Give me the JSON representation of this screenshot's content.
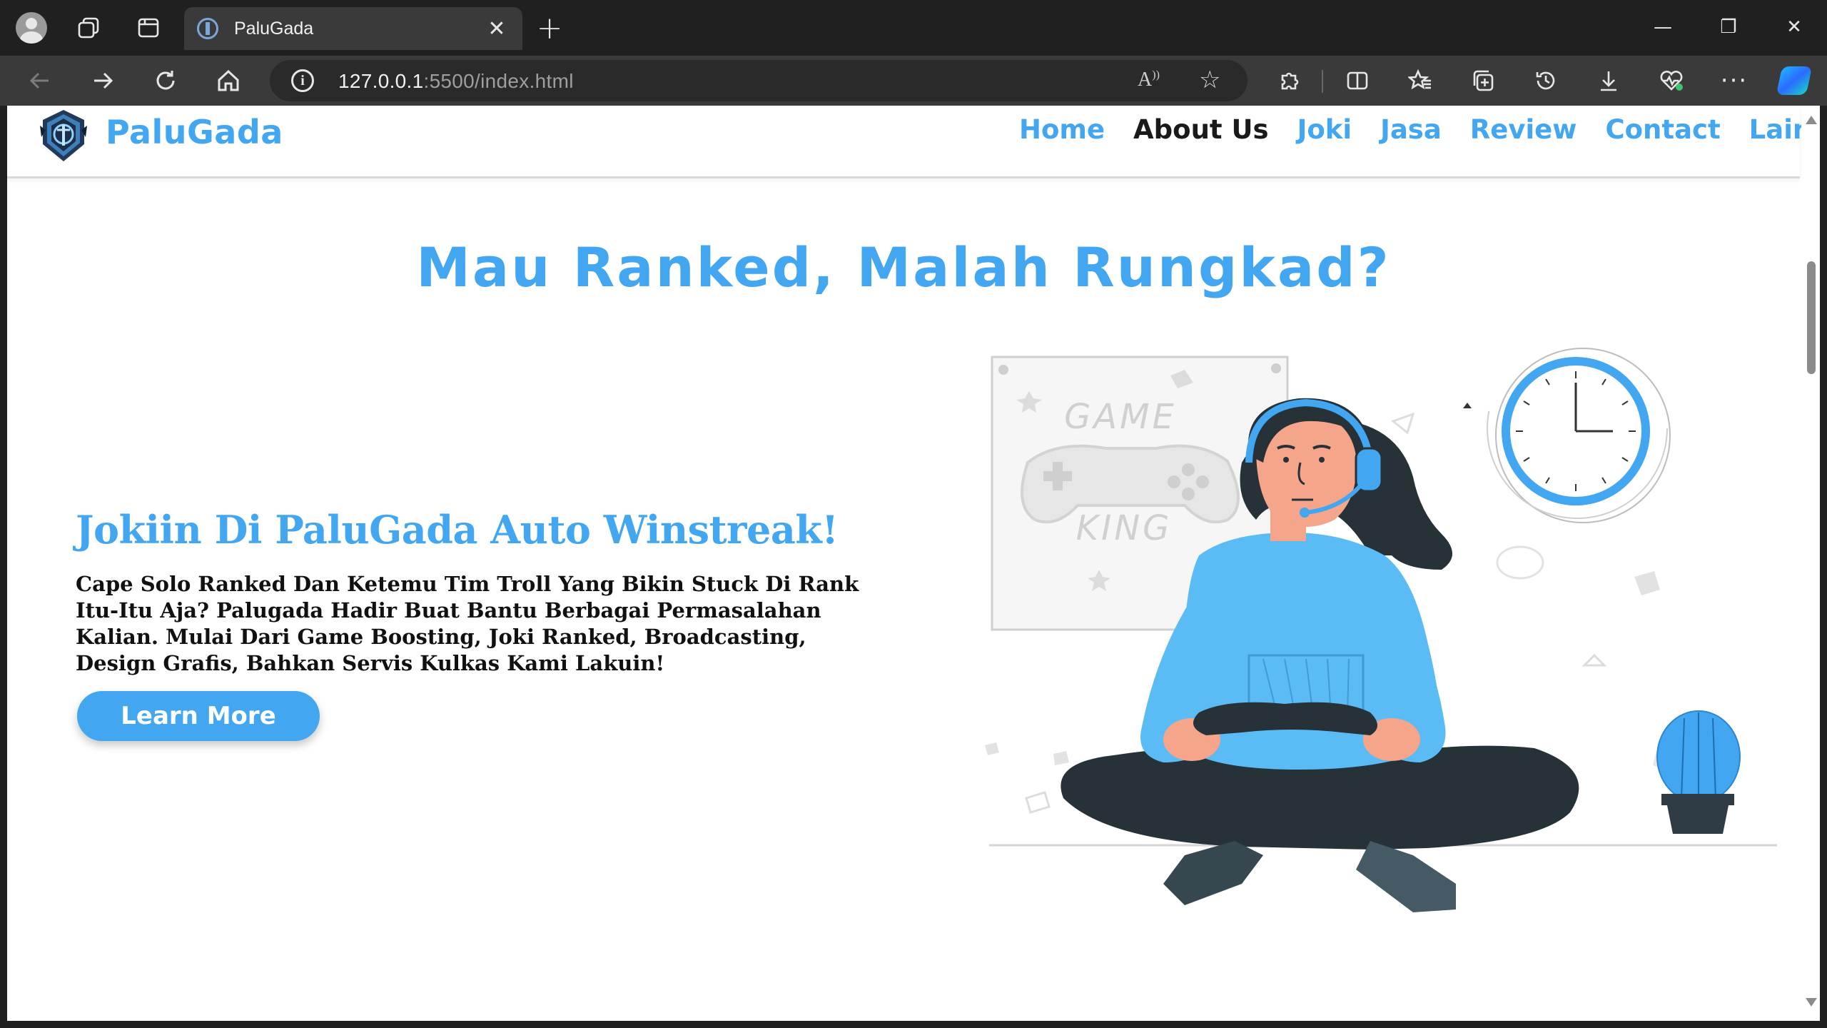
{
  "browser": {
    "tab_title": "PaluGada",
    "tab_close": "✕",
    "new_tab": "+",
    "url_host": "127.0.0.1",
    "url_rest": ":5500/index.html",
    "window": {
      "minimize": "—",
      "maximize": "❐",
      "close": "✕"
    },
    "more_label": "···"
  },
  "site": {
    "brand": "PaluGada",
    "nav": [
      "Home",
      "About Us",
      "Joki",
      "Jasa",
      "Review",
      "Contact",
      "Lainnya"
    ],
    "active_nav": "About Us",
    "hero_title": "Mau Ranked, Malah Rungkad?",
    "headline": "Jokiin Di PaluGada Auto Winstreak!",
    "description": "Cape Solo Ranked Dan Ketemu Tim Troll Yang Bikin Stuck Di Rank Itu-Itu Aja? Palugada Hadir Buat Bantu Berbagai Permasalahan Kalian. Mulai Dari Game Boosting, Joki Ranked, Broadcasting, Design Grafis, Bahkan Servis Kulkas Kami Lakuin!",
    "cta": "Learn More",
    "illustration": {
      "poster_line1": "GAME",
      "poster_line2": "KING"
    }
  },
  "colors": {
    "accent": "#42a6f0",
    "chrome_dark": "#202020",
    "chrome_toolbar": "#3a3a3a",
    "text_dark": "#111111"
  },
  "icons": [
    "profile-icon",
    "workspaces-icon",
    "tab-actions-icon",
    "back-icon",
    "forward-icon",
    "reload-icon",
    "home-icon",
    "site-info-icon",
    "read-aloud-icon",
    "favorite-star-icon",
    "extensions-icon",
    "split-screen-icon",
    "favorites-icon",
    "collections-icon",
    "history-icon",
    "downloads-icon",
    "browser-health-icon",
    "more-icon",
    "copilot-icon"
  ]
}
